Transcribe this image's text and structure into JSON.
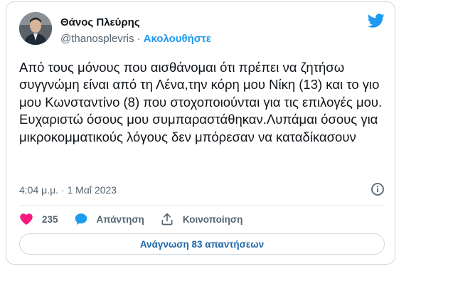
{
  "author": {
    "name": "Θάνος Πλεύρης",
    "handle": "@thanosplevris",
    "separator": "·",
    "follow_label": "Ακολουθήστε"
  },
  "tweet": {
    "text": "Από τους μόνους που αισθάνομαι ότι πρέπει να ζητήσω συγγνώμη είναι από τη Λένα,την κόρη μου Νίκη (13) και το γιο μου Κωνσταντίνο (8) που στοχοποιούνται για τις επιλογές μου. Ευχαριστώ όσους μου συμπαραστάθηκαν.Λυπάμαι όσους για μικροκομματικούς λόγους δεν μπόρεσαν να καταδίκασουν",
    "timestamp": "4:04 μ.μ. · 1 Μαΐ 2023"
  },
  "actions": {
    "likes_count": "235",
    "reply_label": "Απάντηση",
    "share_label": "Κοινοποίηση"
  },
  "read_replies_label": "Ανάγνωση 83 απαντήσεων",
  "icons": {
    "brand": "twitter-bird-icon",
    "like": "heart-icon",
    "reply": "speech-bubble-icon",
    "share": "share-upload-icon",
    "info": "info-icon"
  },
  "colors": {
    "accent": "#1d9bf0",
    "like": "#f91880",
    "text": "#0f1419",
    "muted": "#536471",
    "border": "#cfd9de"
  }
}
